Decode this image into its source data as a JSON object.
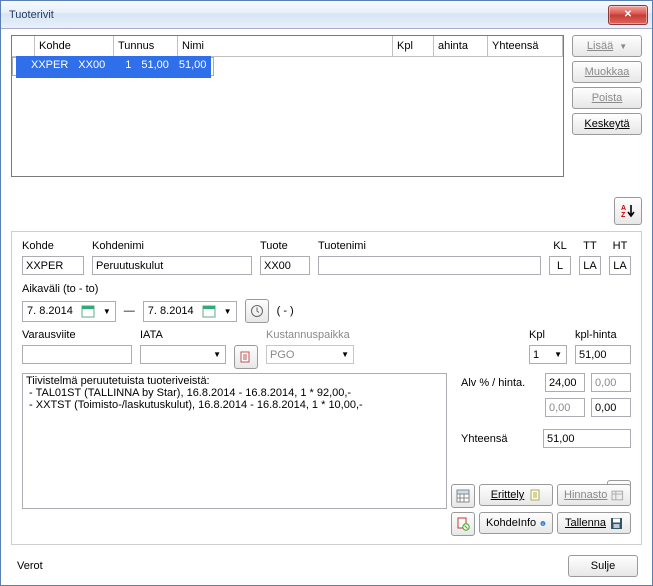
{
  "title": "Tuoterivit",
  "buttons": {
    "add": "Lisää",
    "edit": "Muokkaa",
    "delete": "Poista",
    "cancel": "Keskeytä",
    "close": "Sulje",
    "breakdown": "Erittely",
    "pricelist": "Hinnasto",
    "targetinfo": "KohdeInfo",
    "save": "Tallenna"
  },
  "grid": {
    "headers": {
      "kohde": "Kohde",
      "tunnus": "Tunnus",
      "nimi": "Nimi",
      "kpl": "Kpl",
      "ahinta": "ahinta",
      "yhteensa": "Yhteensä"
    },
    "row": {
      "kohde": "XXPER",
      "tunnus": "XX00",
      "nimi": "",
      "kpl": "1",
      "ahinta": "51,00",
      "yhteensa": "51,00"
    }
  },
  "labels": {
    "kohde": "Kohde",
    "kohdenimi": "Kohdenimi",
    "tuote": "Tuote",
    "tuotenimi": "Tuotenimi",
    "kl": "KL",
    "tt": "TT",
    "ht": "HT",
    "aikavali": "Aikaväli (to - to)",
    "varausviite": "Varausviite",
    "iata": "IATA",
    "kustannuspaikka": "Kustannuspaikka",
    "kpl": "Kpl",
    "kplhinta": "kpl-hinta",
    "alvhinta": "Alv % / hinta.",
    "yhteensa": "Yhteensä",
    "verot": "Verot",
    "datesep": "—",
    "paren": "( - )"
  },
  "form": {
    "kohde": "XXPER",
    "kohdenimi": "Peruutuskulut",
    "tuote": "XX00",
    "tuotenimi": "",
    "kl": "L",
    "tt": "LA",
    "ht": "LA",
    "date1": "  7.  8.2014",
    "date2": "  7.  8.2014",
    "varausviite": "",
    "iata": "",
    "kustannuspaikka": "PGO",
    "kpl": "1",
    "kplhinta": "51,00",
    "alvpct": "24,00",
    "alvhinta": "0,00",
    "blank1": "0,00",
    "blank2": "0,00",
    "yhteensa": "51,00",
    "summary": "Tiivistelmä peruutetuista tuoteriveistä:\n - TAL01ST (TALLINNA by Star), 16.8.2014 - 16.8.2014, 1 * 92,00,-\n - XXTST (Toimisto-/laskutuskulut), 16.8.2014 - 16.8.2014, 1 * 10,00,-"
  },
  "chart_data": {
    "type": "table",
    "title": "Tuoterivit",
    "columns": [
      "Kohde",
      "Tunnus",
      "Nimi",
      "Kpl",
      "ahinta",
      "Yhteensä"
    ],
    "rows": [
      [
        "XXPER",
        "XX00",
        "",
        1,
        51.0,
        51.0
      ]
    ]
  }
}
